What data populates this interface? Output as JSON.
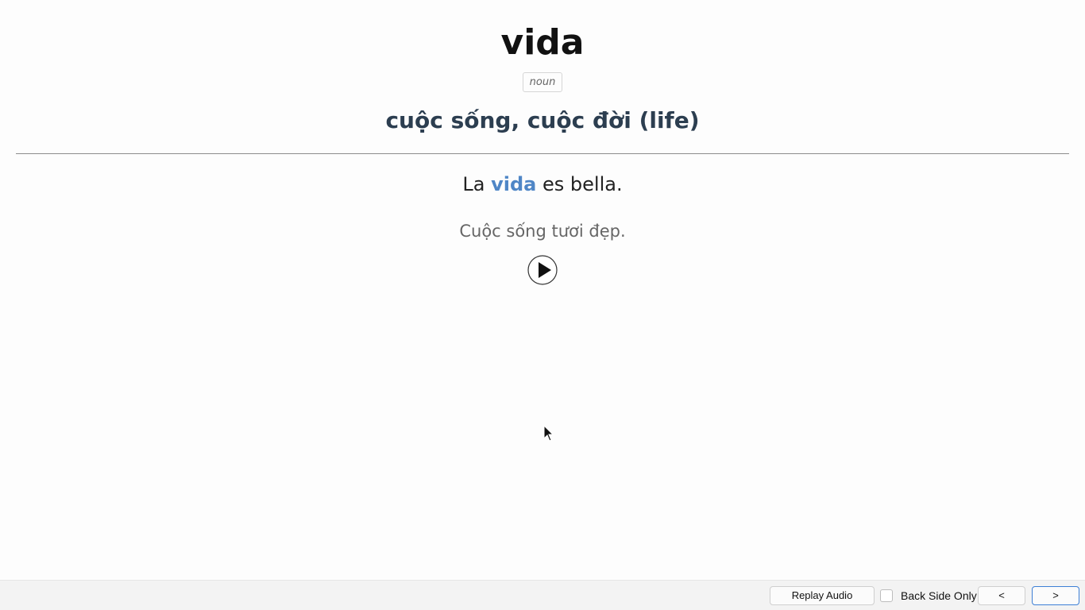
{
  "card": {
    "word": "vida",
    "part_of_speech": "noun",
    "meaning": "cuộc sống, cuộc đời (life)",
    "example": {
      "before": "La ",
      "highlight": "vida",
      "after": " es bella."
    },
    "translation": "Cuộc sống tươi đẹp.",
    "play_icon": "play-circle-icon",
    "highlight_color": "#4f86c6",
    "meaning_color": "#2c3e50"
  },
  "bottombar": {
    "replay_label": "Replay Audio",
    "back_side_only_label": "Back Side Only",
    "back_side_only_checked": false,
    "prev_label": "<",
    "next_label": ">",
    "focus_color": "#3d7fd6"
  }
}
